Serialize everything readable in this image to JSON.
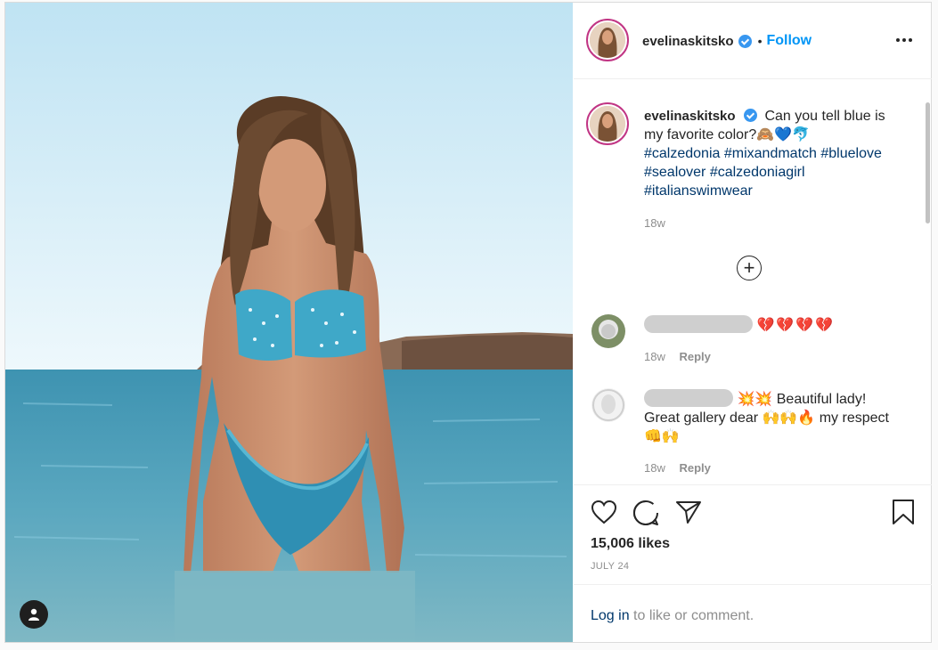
{
  "post": {
    "username": "evelinaskitsko",
    "follow_label": "Follow",
    "separator": "•",
    "caption": {
      "text": "Can you tell blue is my favorite color?🙈💙🐬",
      "hashtags": [
        "#calzedonia",
        "#mixandmatch",
        "#bluelove",
        "#sealover",
        "#calzedoniagirl",
        "#italianswimwear"
      ],
      "age": "18w"
    },
    "comments": [
      {
        "emojis": "💔💔💔💔",
        "text": "",
        "age": "18w",
        "reply_label": "Reply"
      },
      {
        "emojis": "💥💥",
        "text": "Beautiful lady! Great gallery dear 🙌🙌🔥 my respect 👊🙌",
        "age": "18w",
        "reply_label": "Reply"
      }
    ],
    "likes": "15,006 likes",
    "date": "JULY 24",
    "login_link": "Log in",
    "login_text": " to like or comment."
  },
  "icons": [
    "heart-icon",
    "comment-icon",
    "share-icon",
    "bookmark-icon",
    "more-options-icon",
    "load-more-icon",
    "user-tag-icon"
  ]
}
